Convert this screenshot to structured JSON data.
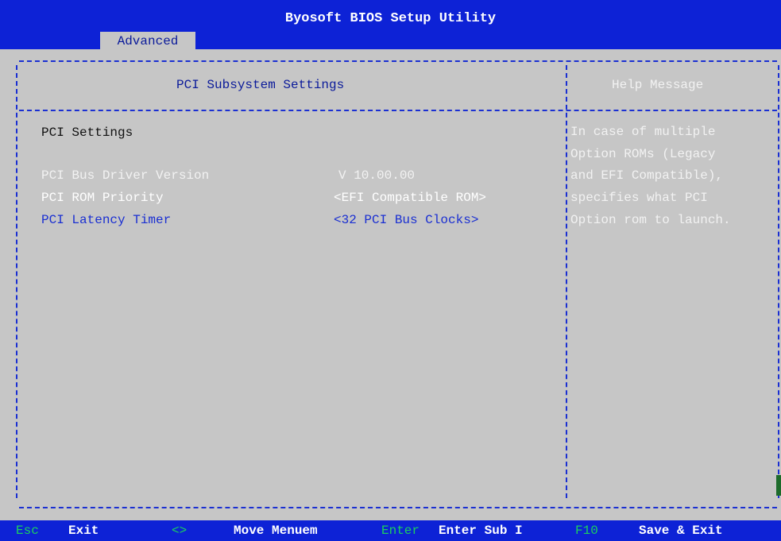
{
  "header": {
    "title": "Byosoft BIOS Setup Utility",
    "active_tab": "Advanced"
  },
  "main": {
    "section_title": "PCI Subsystem Settings",
    "group_label": "PCI Settings",
    "items": [
      {
        "label": "PCI Bus Driver Version",
        "value": "V 10.00.00"
      },
      {
        "label": "PCI ROM Priority",
        "value": "<EFI Compatible ROM>"
      },
      {
        "label": "PCI Latency Timer",
        "value": "<32 PCI Bus Clocks>"
      }
    ]
  },
  "help": {
    "title": "Help Message",
    "lines": [
      "In case of multiple",
      "Option ROMs (Legacy",
      "and EFI Compatible),",
      "specifies what PCI",
      "Option rom to launch."
    ]
  },
  "footer": {
    "keys": [
      {
        "key": "Esc",
        "desc": "Exit"
      },
      {
        "key": "<>",
        "desc": "Move Menuem"
      },
      {
        "key": "Enter",
        "desc": "Enter Sub I"
      },
      {
        "key": "F10",
        "desc": "Save & Exit"
      }
    ]
  },
  "colors": {
    "background": "#c6c6c6",
    "bar_blue": "#0d22d6",
    "selected_text": "#ffffff",
    "disabled_text": "#f2f2f2",
    "key_green": "#1ccf5e"
  }
}
